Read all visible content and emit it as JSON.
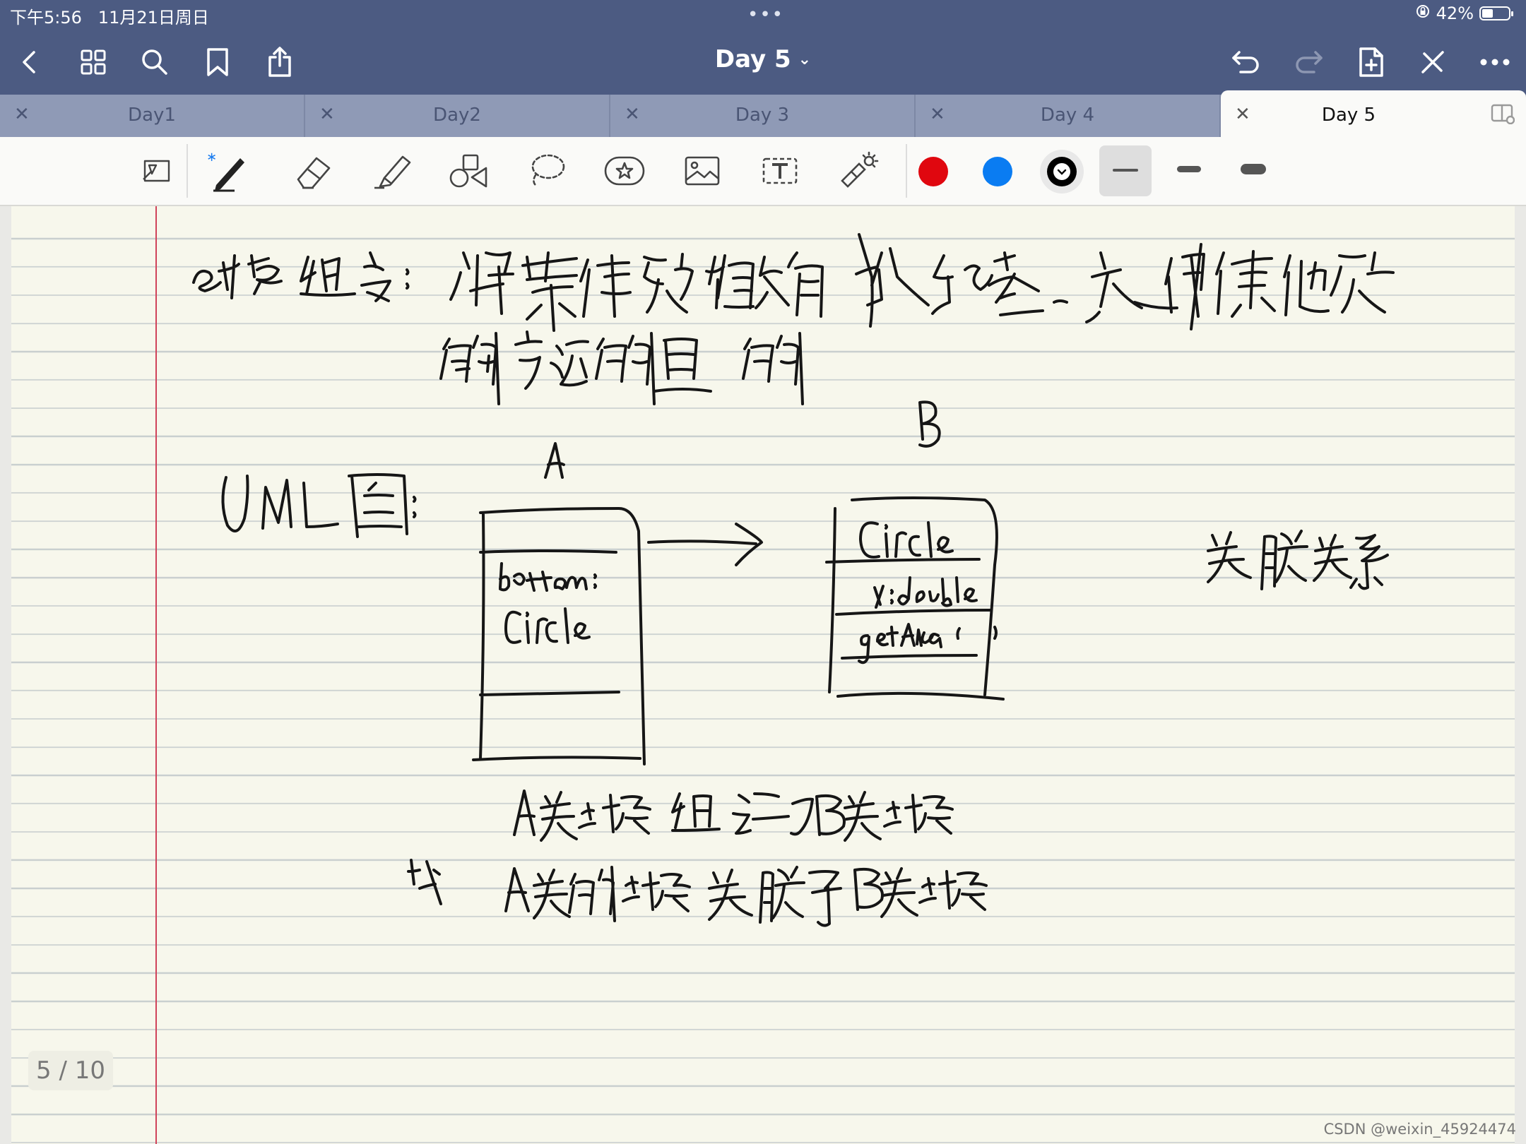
{
  "status_bar": {
    "time": "下午5:56",
    "date": "11月21日周日",
    "battery": "42%",
    "battery_level": 0.42
  },
  "nav_bar": {
    "title": "Day 5"
  },
  "tabs": [
    {
      "label": "Day1",
      "active": false
    },
    {
      "label": "Day2",
      "active": false
    },
    {
      "label": "Day 3",
      "active": false
    },
    {
      "label": "Day 4",
      "active": false
    },
    {
      "label": "Day 5",
      "active": true
    }
  ],
  "toolbar": {
    "tools": [
      "lasso-select",
      "pen",
      "eraser",
      "highlighter",
      "shapes",
      "lasso",
      "sticker",
      "image",
      "text",
      "laser-pointer"
    ],
    "colors": [
      "#e0070f",
      "#0a7cf2",
      "#000000"
    ],
    "selected_color": "#000000",
    "stroke_sizes": [
      "thin",
      "medium",
      "thick"
    ],
    "selected_stroke": "thin"
  },
  "page": {
    "indicator": "5 / 10"
  },
  "watermark": "CSDN @weixin_45924474"
}
